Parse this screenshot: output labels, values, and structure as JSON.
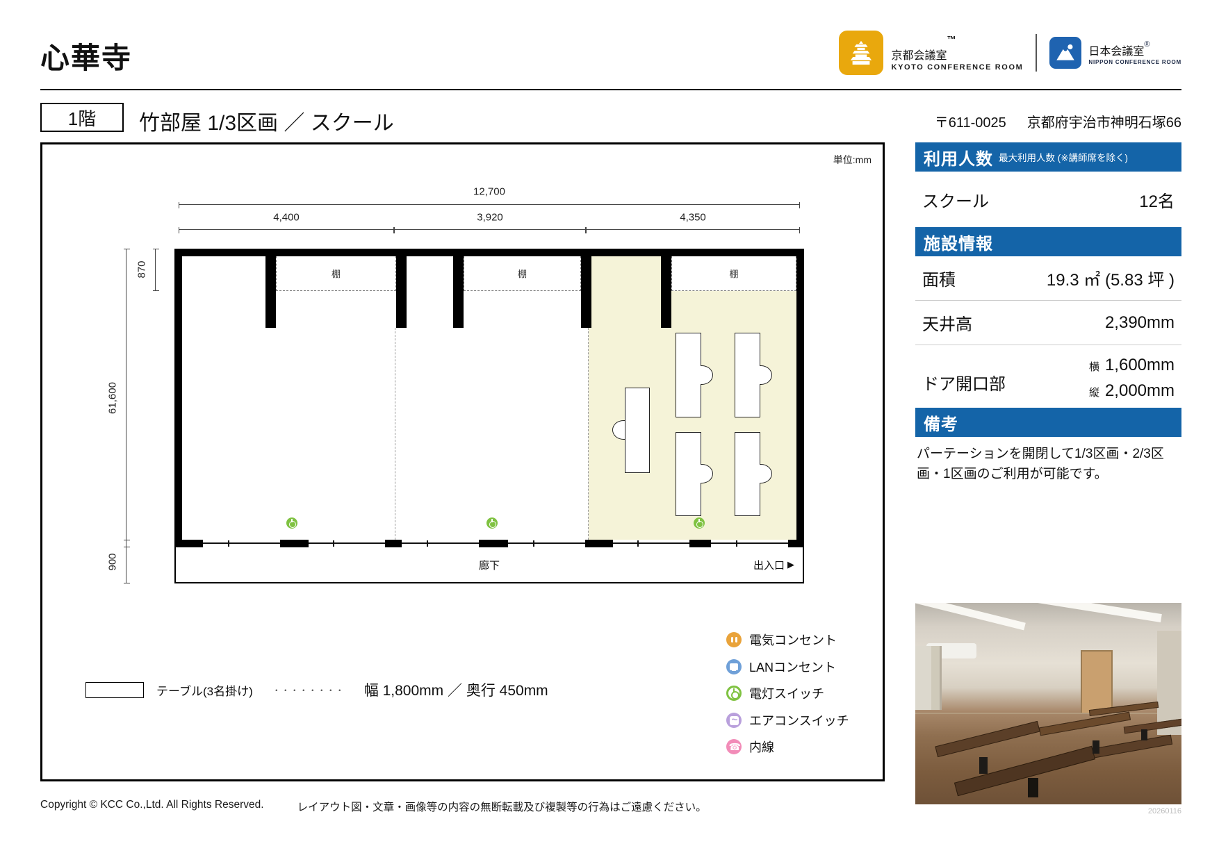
{
  "page": {
    "title": "心華寺",
    "floor_badge": "1階",
    "room_title": "竹部屋 1/3区画 ／ スクール",
    "address_zip": "〒611-0025",
    "address_text": "京都府宇治市神明石塚66",
    "footer_copyright": "Copyright © KCC Co.,Ltd. All Rights Reserved.",
    "footer_notice": "レイアウト図・文章・画像等の内容の無断転載及び複製等の行為はご遠慮ください。",
    "date_code": "20260116"
  },
  "logos": {
    "kyoto": {
      "name": "京都会議室",
      "mark": "™",
      "sub": "KYOTO CONFERENCE ROOM",
      "color": "#E9A80D"
    },
    "nippon": {
      "name": "日本会議室",
      "mark": "®",
      "sub": "NIPPON CONFERENCE ROOM",
      "color": "#1F63B0"
    }
  },
  "sidebar": {
    "accent_color": "#1464A8",
    "capacity_header": "利用人数",
    "capacity_note": "最大利用人数 (※講師席を除く)",
    "capacity_label": "スクール",
    "capacity_value": "12名",
    "facility_header": "施設情報",
    "area_label": "面積",
    "area_value": "19.3 ㎡ (5.83 坪 )",
    "ceiling_label": "天井高",
    "ceiling_value": "2,390mm",
    "door_label": "ドア開口部",
    "door_w_key": "横",
    "door_w_val": "1,600mm",
    "door_h_key": "縦",
    "door_h_val": "2,000mm",
    "remarks_header": "備考",
    "remarks_text": "パーテーションを開閉して1/3区画・2/3区画・1区画のご利用が可能です。"
  },
  "plan": {
    "unit_note": "単位:mm",
    "dim_total": "12,700",
    "dim_segments": [
      "4,400",
      "3,920",
      "4,350"
    ],
    "dim_shelf_depth": "870",
    "dim_room_height": "61,600",
    "dim_corridor": "900",
    "shelf_label": "棚",
    "corridor_label": "廊下",
    "exit_label": "出入口",
    "exit_arrow": "▶",
    "highlight_color": "#F5F3D8"
  },
  "legend": {
    "table_label": "テーブル(3名掛け)",
    "table_dots": "・・・・・・・・",
    "table_size": "幅 1,800mm ／ 奥行 450mm",
    "items": [
      {
        "label": "電気コンセント",
        "color": "#E9A33B"
      },
      {
        "label": "LANコンセント",
        "color": "#6FA0D8"
      },
      {
        "label": "電灯スイッチ",
        "color": "#7FC241"
      },
      {
        "label": "エアコンスイッチ",
        "color": "#B9A0DC"
      },
      {
        "label": "内線",
        "color": "#F28CB8"
      }
    ]
  }
}
